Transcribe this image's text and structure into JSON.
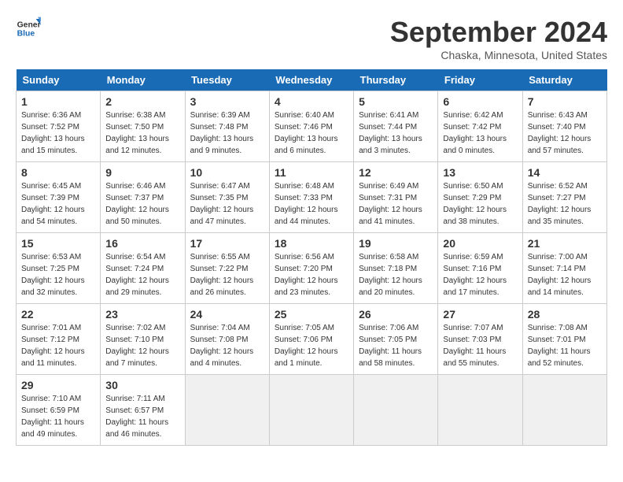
{
  "header": {
    "logo_line1": "General",
    "logo_line2": "Blue",
    "month": "September 2024",
    "location": "Chaska, Minnesota, United States"
  },
  "days_of_week": [
    "Sunday",
    "Monday",
    "Tuesday",
    "Wednesday",
    "Thursday",
    "Friday",
    "Saturday"
  ],
  "weeks": [
    [
      {
        "day": 1,
        "sunrise": "6:36 AM",
        "sunset": "7:52 PM",
        "daylight": "13 hours and 15 minutes."
      },
      {
        "day": 2,
        "sunrise": "6:38 AM",
        "sunset": "7:50 PM",
        "daylight": "13 hours and 12 minutes."
      },
      {
        "day": 3,
        "sunrise": "6:39 AM",
        "sunset": "7:48 PM",
        "daylight": "13 hours and 9 minutes."
      },
      {
        "day": 4,
        "sunrise": "6:40 AM",
        "sunset": "7:46 PM",
        "daylight": "13 hours and 6 minutes."
      },
      {
        "day": 5,
        "sunrise": "6:41 AM",
        "sunset": "7:44 PM",
        "daylight": "13 hours and 3 minutes."
      },
      {
        "day": 6,
        "sunrise": "6:42 AM",
        "sunset": "7:42 PM",
        "daylight": "13 hours and 0 minutes."
      },
      {
        "day": 7,
        "sunrise": "6:43 AM",
        "sunset": "7:40 PM",
        "daylight": "12 hours and 57 minutes."
      }
    ],
    [
      {
        "day": 8,
        "sunrise": "6:45 AM",
        "sunset": "7:39 PM",
        "daylight": "12 hours and 54 minutes."
      },
      {
        "day": 9,
        "sunrise": "6:46 AM",
        "sunset": "7:37 PM",
        "daylight": "12 hours and 50 minutes."
      },
      {
        "day": 10,
        "sunrise": "6:47 AM",
        "sunset": "7:35 PM",
        "daylight": "12 hours and 47 minutes."
      },
      {
        "day": 11,
        "sunrise": "6:48 AM",
        "sunset": "7:33 PM",
        "daylight": "12 hours and 44 minutes."
      },
      {
        "day": 12,
        "sunrise": "6:49 AM",
        "sunset": "7:31 PM",
        "daylight": "12 hours and 41 minutes."
      },
      {
        "day": 13,
        "sunrise": "6:50 AM",
        "sunset": "7:29 PM",
        "daylight": "12 hours and 38 minutes."
      },
      {
        "day": 14,
        "sunrise": "6:52 AM",
        "sunset": "7:27 PM",
        "daylight": "12 hours and 35 minutes."
      }
    ],
    [
      {
        "day": 15,
        "sunrise": "6:53 AM",
        "sunset": "7:25 PM",
        "daylight": "12 hours and 32 minutes."
      },
      {
        "day": 16,
        "sunrise": "6:54 AM",
        "sunset": "7:24 PM",
        "daylight": "12 hours and 29 minutes."
      },
      {
        "day": 17,
        "sunrise": "6:55 AM",
        "sunset": "7:22 PM",
        "daylight": "12 hours and 26 minutes."
      },
      {
        "day": 18,
        "sunrise": "6:56 AM",
        "sunset": "7:20 PM",
        "daylight": "12 hours and 23 minutes."
      },
      {
        "day": 19,
        "sunrise": "6:58 AM",
        "sunset": "7:18 PM",
        "daylight": "12 hours and 20 minutes."
      },
      {
        "day": 20,
        "sunrise": "6:59 AM",
        "sunset": "7:16 PM",
        "daylight": "12 hours and 17 minutes."
      },
      {
        "day": 21,
        "sunrise": "7:00 AM",
        "sunset": "7:14 PM",
        "daylight": "12 hours and 14 minutes."
      }
    ],
    [
      {
        "day": 22,
        "sunrise": "7:01 AM",
        "sunset": "7:12 PM",
        "daylight": "12 hours and 11 minutes."
      },
      {
        "day": 23,
        "sunrise": "7:02 AM",
        "sunset": "7:10 PM",
        "daylight": "12 hours and 7 minutes."
      },
      {
        "day": 24,
        "sunrise": "7:04 AM",
        "sunset": "7:08 PM",
        "daylight": "12 hours and 4 minutes."
      },
      {
        "day": 25,
        "sunrise": "7:05 AM",
        "sunset": "7:06 PM",
        "daylight": "12 hours and 1 minute."
      },
      {
        "day": 26,
        "sunrise": "7:06 AM",
        "sunset": "7:05 PM",
        "daylight": "11 hours and 58 minutes."
      },
      {
        "day": 27,
        "sunrise": "7:07 AM",
        "sunset": "7:03 PM",
        "daylight": "11 hours and 55 minutes."
      },
      {
        "day": 28,
        "sunrise": "7:08 AM",
        "sunset": "7:01 PM",
        "daylight": "11 hours and 52 minutes."
      }
    ],
    [
      {
        "day": 29,
        "sunrise": "7:10 AM",
        "sunset": "6:59 PM",
        "daylight": "11 hours and 49 minutes."
      },
      {
        "day": 30,
        "sunrise": "7:11 AM",
        "sunset": "6:57 PM",
        "daylight": "11 hours and 46 minutes."
      },
      null,
      null,
      null,
      null,
      null
    ]
  ]
}
